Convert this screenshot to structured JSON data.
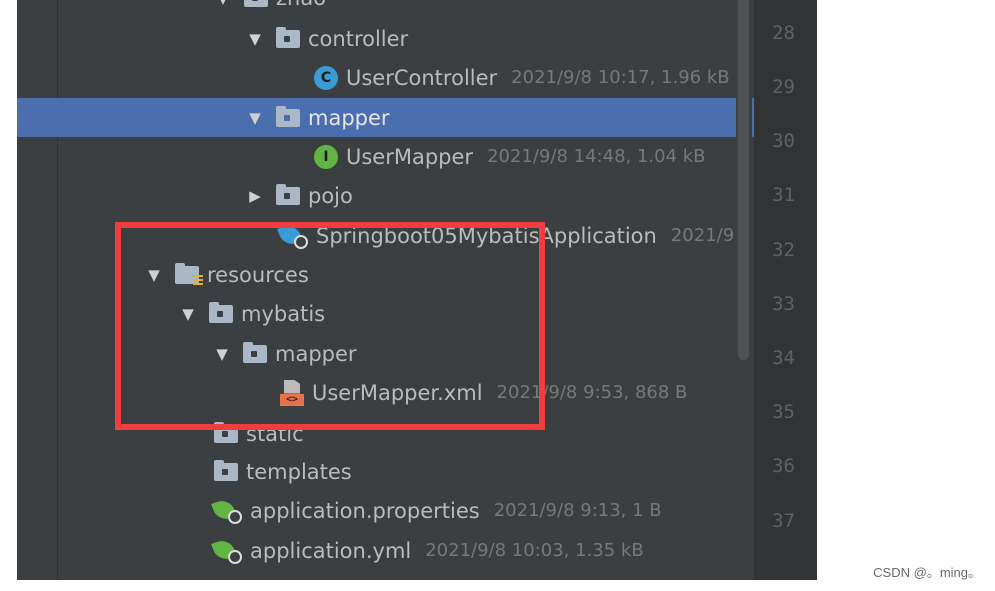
{
  "tree": {
    "rows": [
      {
        "arrow": "▼",
        "name": "zhao",
        "meta": ""
      },
      {
        "arrow": "▼",
        "name": "controller",
        "meta": ""
      },
      {
        "arrow": "",
        "name": "UserController",
        "meta": "2021/9/8 10:17, 1.96 kB",
        "icon_label": "C"
      },
      {
        "arrow": "▼",
        "name": "mapper",
        "meta": ""
      },
      {
        "arrow": "",
        "name": "UserMapper",
        "meta": "2021/9/8 14:48, 1.04 kB",
        "icon_label": "I"
      },
      {
        "arrow": "▶",
        "name": "pojo",
        "meta": ""
      },
      {
        "arrow": "",
        "name": "Springboot05MybatisApplication",
        "meta": "2021/9"
      },
      {
        "arrow": "▼",
        "name": "resources",
        "meta": ""
      },
      {
        "arrow": "▼",
        "name": "mybatis",
        "meta": ""
      },
      {
        "arrow": "▼",
        "name": "mapper",
        "meta": ""
      },
      {
        "arrow": "",
        "name": "UserMapper.xml",
        "meta": "2021/9/8 9:53, 868 B",
        "icon_label": "<>"
      },
      {
        "arrow": "",
        "name": "static",
        "meta": ""
      },
      {
        "arrow": "",
        "name": "templates",
        "meta": ""
      },
      {
        "arrow": "",
        "name": "application.properties",
        "meta": "2021/9/8 9:13, 1 B"
      },
      {
        "arrow": "",
        "name": "application.yml",
        "meta": "2021/9/8 10:03, 1.35 kB"
      }
    ]
  },
  "line_numbers": [
    "28",
    "29",
    "30",
    "31",
    "32",
    "33",
    "34",
    "35",
    "36",
    "37"
  ],
  "watermark": "CSDN @。ming。",
  "colors": {
    "selection": "#4b6eaf",
    "highlight_box": "#f03e3e",
    "panel_bg": "#3c3f41"
  }
}
